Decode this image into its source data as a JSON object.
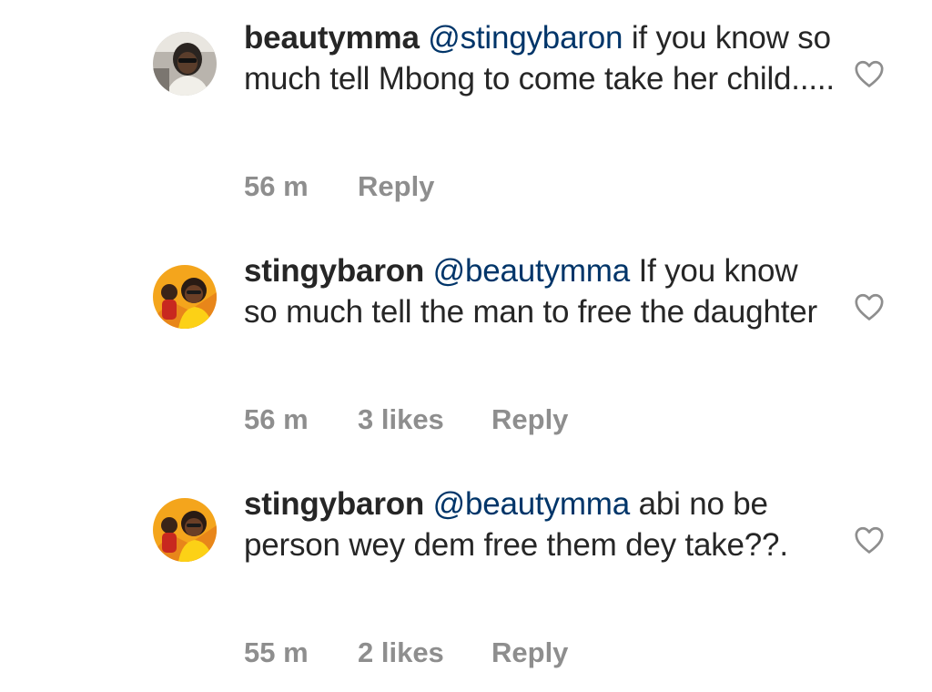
{
  "comments": [
    {
      "username": "beautymma",
      "mention": "@stingybaron",
      "text": "if you know so much tell Mbong to come take her child.....",
      "time": "56 m",
      "likes": "",
      "reply_label": "Reply",
      "avatar_icon": "avatar-beautymma-icon",
      "like_icon": "heart-outline-icon"
    },
    {
      "username": "stingybaron",
      "mention": "@beautymma",
      "text": "If you know so much tell the man to free the daughter",
      "time": "56 m",
      "likes": "3 likes",
      "reply_label": "Reply",
      "avatar_icon": "avatar-stingybaron-icon",
      "like_icon": "heart-outline-icon"
    },
    {
      "username": "stingybaron",
      "mention": "@beautymma",
      "text": "abi no be person wey dem free them dey take??.",
      "time": "55 m",
      "likes": "2 likes",
      "reply_label": "Reply",
      "avatar_icon": "avatar-stingybaron-icon",
      "like_icon": "heart-outline-icon"
    }
  ],
  "colors": {
    "text": "#262626",
    "mention": "#003569",
    "meta": "#8e8e8e",
    "avatar_orange": "#f4a51c"
  }
}
